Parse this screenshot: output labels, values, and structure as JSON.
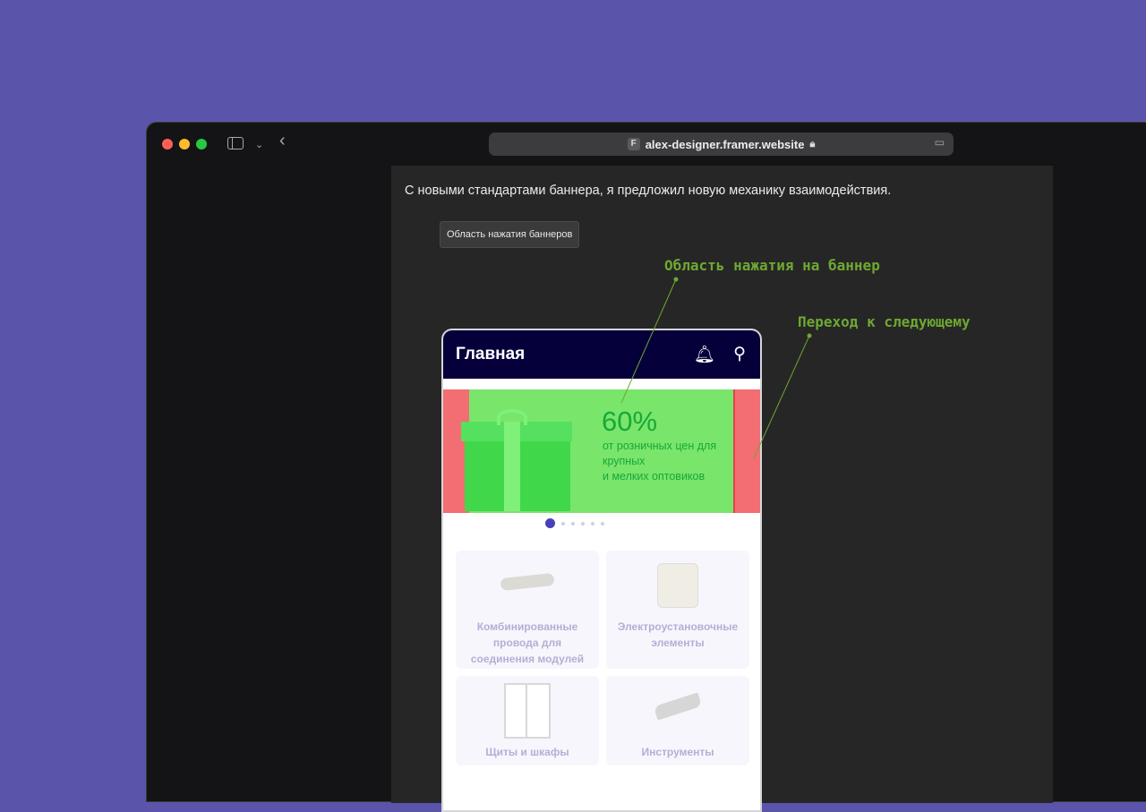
{
  "browser": {
    "url": "alex-designer.framer.website"
  },
  "page": {
    "intro_text": "С новыми стандартами баннера, я предложил новую механику взаимодействия.",
    "tag_button_label": "Область нажатия баннеров",
    "annotations": [
      {
        "text": "Область нажатия на баннер"
      },
      {
        "text": "Переход к следующему"
      }
    ]
  },
  "phone": {
    "header_title": "Главная",
    "banner": {
      "percent": "60%",
      "line1": "от розничных цен для",
      "line2": "крупных",
      "line3": "и мелких оптовиков"
    },
    "carousel": {
      "count": 6,
      "active_index": 0
    },
    "categories": [
      {
        "label": "Комбинированные провода для соединения модулей"
      },
      {
        "label": "Электроустановочные элементы"
      },
      {
        "label": "Щиты и шкафы"
      },
      {
        "label": "Инструменты"
      }
    ]
  },
  "colors": {
    "background": "#5a55ab",
    "annotation": "#6ea832",
    "app_header": "#06003a",
    "banner_green": "#79e56a",
    "banner_side": "#f26e72",
    "carousel_active": "#4a40b8"
  }
}
